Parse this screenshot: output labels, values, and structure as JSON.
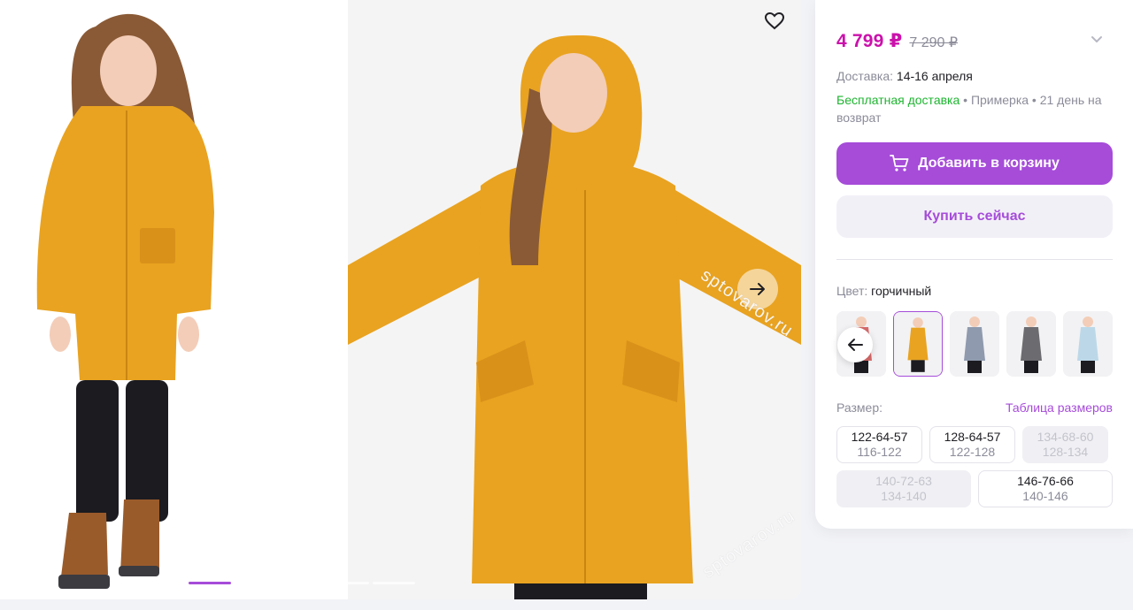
{
  "gallery": {
    "photo1_alt": "",
    "photo2_alt": "",
    "watermarks": [
      "sptovarov.ru",
      "sptovarov.ru"
    ],
    "slides_total": 5,
    "slide_active": 1
  },
  "product": {
    "price": "4 799 ₽",
    "old_price": "7 290 ₽",
    "delivery_label": "Доставка:",
    "delivery_date": "14-16 апреля",
    "free_delivery": "Бесплатная доставка",
    "perks_rest": " • Примерка • 21 день на возврат",
    "add_to_cart": "Добавить в корзину",
    "buy_now": "Купить сейчас",
    "color_label": "Цвет:",
    "color_value": "горчичный",
    "size_label": "Размер:",
    "size_table_link": "Таблица размеров"
  },
  "sizes_row1": [
    {
      "main": "122-64-57",
      "sub": "116-122",
      "available": true
    },
    {
      "main": "128-64-57",
      "sub": "122-128",
      "available": true
    },
    {
      "main": "134-68-60",
      "sub": "128-134",
      "available": false
    }
  ],
  "sizes_row2": [
    {
      "main": "140-72-63",
      "sub": "134-140",
      "available": false
    },
    {
      "main": "146-76-66",
      "sub": "140-146",
      "available": true
    }
  ],
  "swatch_colors": [
    "#d86a6a",
    "#e9a320",
    "#8f9aae",
    "#6c6c70",
    "#bcd8e8"
  ],
  "colors": {
    "accent": "#a64cd9",
    "price": "#cb11ab",
    "free": "#1eb530",
    "coat": "#e9a320"
  }
}
